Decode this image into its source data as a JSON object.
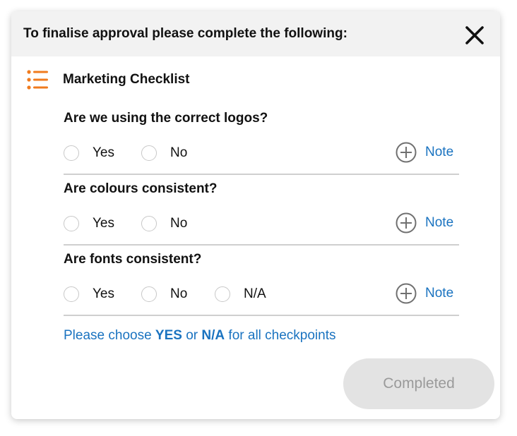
{
  "dialog": {
    "title": "To finalise approval please complete the following:",
    "close_icon": "close-icon"
  },
  "section": {
    "icon": "list-icon",
    "title": "Marketing Checklist",
    "accent_color": "#f07b1e"
  },
  "questions": [
    {
      "label": "Are we using the correct logos?",
      "options": [
        "Yes",
        "No"
      ],
      "note_label": "Note"
    },
    {
      "label": "Are colours consistent?",
      "options": [
        "Yes",
        "No"
      ],
      "note_label": "Note"
    },
    {
      "label": "Are fonts consistent?",
      "options": [
        "Yes",
        "No",
        "N/A"
      ],
      "note_label": "Note"
    }
  ],
  "hint": {
    "part1": "Please choose ",
    "yes": "YES",
    "part2": " or ",
    "na": "N/A",
    "part3": " for all checkpoints",
    "color": "#1a73c0"
  },
  "footer": {
    "completed_label": "Completed",
    "completed_disabled": true
  }
}
